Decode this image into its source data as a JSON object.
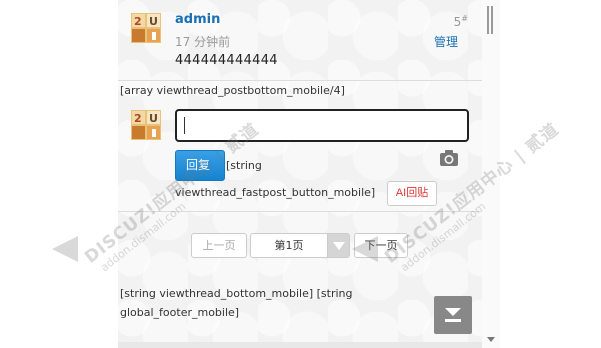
{
  "post": {
    "author": "admin",
    "time": "17 分钟前",
    "floor": "5",
    "floor_mark": "#",
    "manage": "管理",
    "content": "444444444444"
  },
  "postbottom_placeholder": "[array viewthread_postbottom_mobile/4]",
  "reply": {
    "input_value": "",
    "button_label": "回复",
    "fastpost_text_1": "[string",
    "fastpost_text_2": "viewthread_fastpost_button_mobile]",
    "ai_button_label": "AI回贴",
    "camera_icon": "camera-icon"
  },
  "pager": {
    "prev": "上一页",
    "current": "第1页",
    "next": "下一页"
  },
  "bottom_text_1": "[string viewthread_bottom_mobile] [string",
  "bottom_text_2": "global_footer_mobile]",
  "watermark": {
    "brand": "DISCUZ!应用中心 | 贰道",
    "domain": "addon.dismall.com"
  },
  "colors": {
    "link": "#1a6fb5",
    "reply_button": "#1683cf",
    "ai_button_text": "#dd3333",
    "page_bg": "#f2f2f2"
  }
}
